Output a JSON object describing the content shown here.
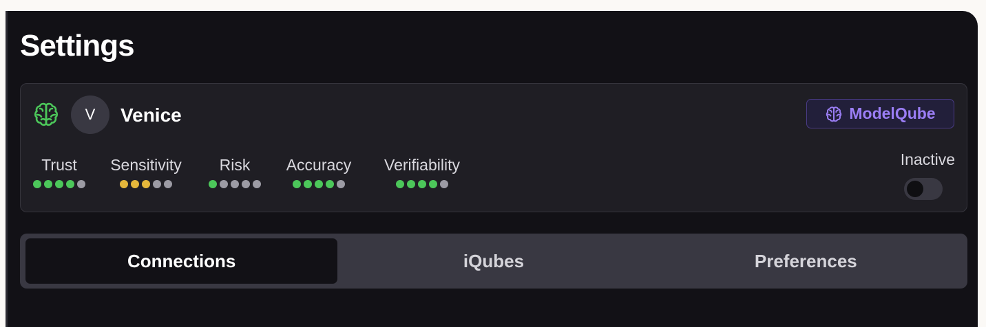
{
  "page": {
    "title": "Settings"
  },
  "model": {
    "avatar_letter": "V",
    "name": "Venice",
    "badge_label": "ModelQube",
    "status_label": "Inactive",
    "active": false
  },
  "metrics": [
    {
      "label": "Trust",
      "dots": [
        "green",
        "green",
        "green",
        "green",
        "gray"
      ]
    },
    {
      "label": "Sensitivity",
      "dots": [
        "yellow",
        "yellow",
        "yellow",
        "gray",
        "gray"
      ]
    },
    {
      "label": "Risk",
      "dots": [
        "green",
        "gray",
        "gray",
        "gray",
        "gray"
      ]
    },
    {
      "label": "Accuracy",
      "dots": [
        "green",
        "green",
        "green",
        "green",
        "gray"
      ]
    },
    {
      "label": "Verifiability",
      "dots": [
        "green",
        "green",
        "green",
        "green",
        "gray"
      ]
    }
  ],
  "tabs": [
    {
      "label": "Connections",
      "active": true
    },
    {
      "label": "iQubes",
      "active": false
    },
    {
      "label": "Preferences",
      "active": false
    }
  ],
  "colors": {
    "green": "#4cc75a",
    "yellow": "#e5b73b",
    "gray": "#9c9ba4",
    "accent": "#9b7ef5"
  }
}
